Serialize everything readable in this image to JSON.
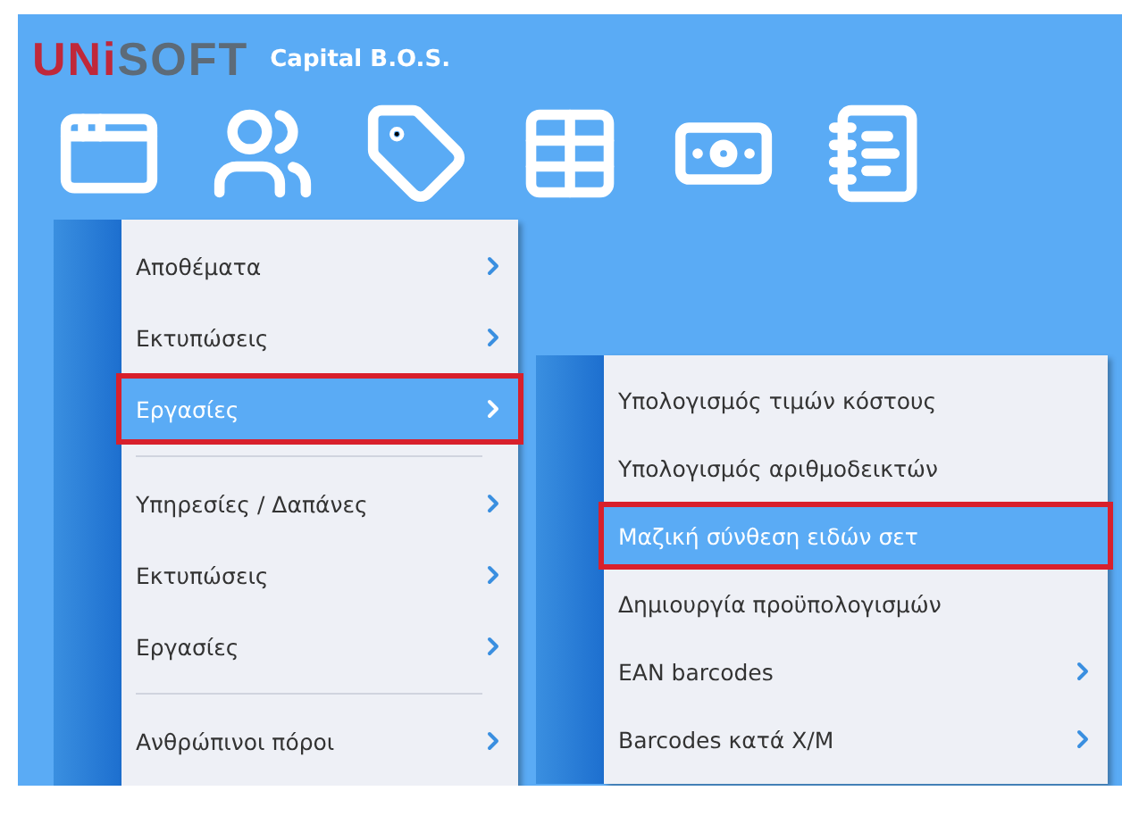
{
  "header": {
    "logo_parts": [
      {
        "text": "UNi",
        "color": "#c0283a"
      },
      {
        "text": "SOFT",
        "color": "#5d6b78"
      }
    ],
    "product": "Capital B.O.S."
  },
  "toolbar": [
    {
      "kind": "window"
    },
    {
      "kind": "users"
    },
    {
      "kind": "tag"
    },
    {
      "kind": "table"
    },
    {
      "kind": "money"
    },
    {
      "kind": "notebook"
    }
  ],
  "menu": {
    "items": [
      {
        "label": "Αποθέματα",
        "submenu": true,
        "selected": false,
        "separator_after": false
      },
      {
        "label": "Εκτυπώσεις",
        "submenu": true,
        "selected": false,
        "separator_after": false
      },
      {
        "label": "Εργασίες",
        "submenu": true,
        "selected": true,
        "separator_after": true
      },
      {
        "label": "Υπηρεσίες / Δαπάνες",
        "submenu": true,
        "selected": false,
        "separator_after": false
      },
      {
        "label": "Εκτυπώσεις",
        "submenu": true,
        "selected": false,
        "separator_after": false
      },
      {
        "label": "Εργασίες",
        "submenu": true,
        "selected": false,
        "separator_after": true
      },
      {
        "label": "Ανθρώπινοι πόροι",
        "submenu": true,
        "selected": false,
        "separator_after": false
      }
    ]
  },
  "submenu": {
    "items": [
      {
        "label": "Υπολογισμός τιμών κόστους",
        "submenu": false,
        "selected": false
      },
      {
        "label": "Υπολογισμός αριθμοδεικτών",
        "submenu": false,
        "selected": false
      },
      {
        "label": "Μαζική σύνθεση ειδών σετ",
        "submenu": false,
        "selected": true
      },
      {
        "label": "Δημιουργία προϋπολογισμών",
        "submenu": false,
        "selected": false
      },
      {
        "label": "EAN barcodes",
        "submenu": true,
        "selected": false
      },
      {
        "label": "Barcodes κατά Χ/Μ",
        "submenu": true,
        "selected": false
      }
    ]
  }
}
